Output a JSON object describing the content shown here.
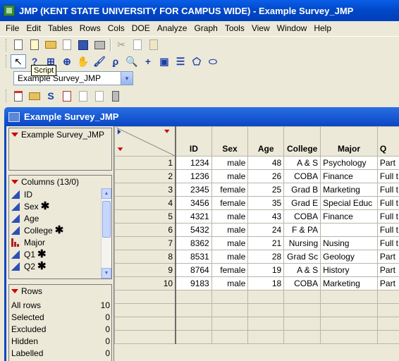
{
  "window": {
    "title": "JMP (KENT STATE UNIVERSITY FOR CAMPUS WIDE)  - Example Survey_JMP"
  },
  "menu": [
    "File",
    "Edit",
    "Tables",
    "Rows",
    "Cols",
    "DOE",
    "Analyze",
    "Graph",
    "Tools",
    "View",
    "Window",
    "Help"
  ],
  "toolbar": {
    "tooltip": "Script",
    "table_selector": "Example Survey_JMP"
  },
  "data_window": {
    "title": "Example Survey_JMP",
    "table_name": "Example Survey_JMP",
    "columns_header": "Columns (13/0)",
    "columns": [
      {
        "name": "ID",
        "type": "continuous",
        "starred": false
      },
      {
        "name": "Sex",
        "type": "continuous",
        "starred": true
      },
      {
        "name": "Age",
        "type": "continuous",
        "starred": false
      },
      {
        "name": "College",
        "type": "continuous",
        "starred": true
      },
      {
        "name": "Major",
        "type": "nominal",
        "starred": false
      },
      {
        "name": "Q1",
        "type": "continuous",
        "starred": true
      },
      {
        "name": "Q2",
        "type": "continuous",
        "starred": true
      }
    ],
    "rows_header": "Rows",
    "row_states": [
      {
        "label": "All rows",
        "value": "10"
      },
      {
        "label": "Selected",
        "value": "0"
      },
      {
        "label": "Excluded",
        "value": "0"
      },
      {
        "label": "Hidden",
        "value": "0"
      },
      {
        "label": "Labelled",
        "value": "0"
      }
    ]
  },
  "grid": {
    "headers": [
      "ID",
      "Sex",
      "Age",
      "College",
      "Major",
      "Q"
    ],
    "rows": [
      {
        "n": "1",
        "id": "1234",
        "sex": "male",
        "age": "48",
        "college": "A & S",
        "major": "Psychology",
        "q": "Part"
      },
      {
        "n": "2",
        "id": "1236",
        "sex": "male",
        "age": "26",
        "college": "COBA",
        "major": "Finance",
        "q": "Full t"
      },
      {
        "n": "3",
        "id": "2345",
        "sex": "female",
        "age": "25",
        "college": "Grad B",
        "major": "Marketing",
        "q": "Full t"
      },
      {
        "n": "4",
        "id": "3456",
        "sex": "female",
        "age": "35",
        "college": "Grad E",
        "major": "Special Educ",
        "q": "Full t"
      },
      {
        "n": "5",
        "id": "4321",
        "sex": "male",
        "age": "43",
        "college": "COBA",
        "major": "Finance",
        "q": "Full t"
      },
      {
        "n": "6",
        "id": "5432",
        "sex": "male",
        "age": "24",
        "college": "F & PA",
        "major": "",
        "q": "Full t"
      },
      {
        "n": "7",
        "id": "8362",
        "sex": "male",
        "age": "21",
        "college": "Nursing",
        "major": "Nusing",
        "q": "Full t"
      },
      {
        "n": "8",
        "id": "8531",
        "sex": "male",
        "age": "28",
        "college": "Grad Sc",
        "major": "Geology",
        "q": "Part"
      },
      {
        "n": "9",
        "id": "8764",
        "sex": "female",
        "age": "19",
        "college": "A & S",
        "major": "History",
        "q": "Part"
      },
      {
        "n": "10",
        "id": "9183",
        "sex": "male",
        "age": "18",
        "college": "COBA",
        "major": "Marketing",
        "q": "Part"
      }
    ]
  }
}
